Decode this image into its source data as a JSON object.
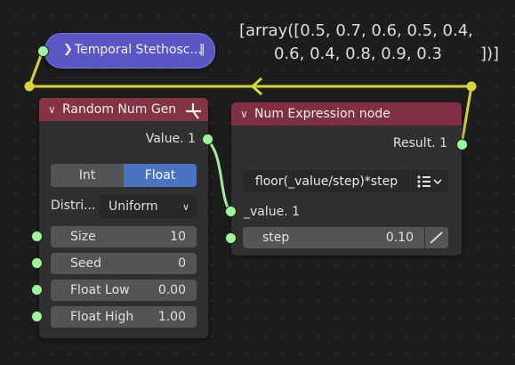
{
  "reroute_node": {
    "label": "Temporal Stethosc...",
    "pin_glyph": "‖"
  },
  "viewer_text": {
    "line1": "[array([0.5, 0.7, 0.6, 0.5, 0.4,",
    "line2": "0.6, 0.4, 0.8, 0.9, 0.3",
    "line3": "])]"
  },
  "random_node": {
    "title": "Random Num Gen",
    "output_label": "Value. 1",
    "mode_options": [
      "Int",
      "Float"
    ],
    "mode_selected": "Float",
    "distribution_label": "Distri...",
    "distribution_value": "Uniform",
    "fields": [
      {
        "label": "Size",
        "value": "10"
      },
      {
        "label": "Seed",
        "value": "0"
      },
      {
        "label": "Float Low",
        "value": "0.00"
      },
      {
        "label": "Float High",
        "value": "1.00"
      }
    ]
  },
  "expr_node": {
    "title": "Num Expression node",
    "output_label": "Result. 1",
    "expression": "floor(_value/step)*step",
    "input_value_label": "_value. 1",
    "step_label": "step",
    "step_value": "0.10"
  },
  "colors": {
    "socket": "#9ff59a",
    "link_green": "#a6e8a0",
    "link_yellow": "#d6d43a",
    "expr_header": "#803044",
    "random_header": "#843443",
    "reroute_body": "#5a56c4",
    "toggle_active": "#4a73c0"
  },
  "icons": {
    "collapse": "chevron-down-icon",
    "list": "list-menu-icon",
    "curve": "curve-icon"
  }
}
